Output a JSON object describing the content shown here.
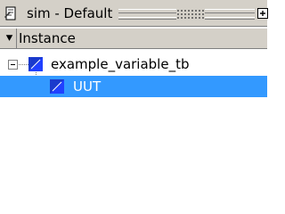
{
  "window": {
    "title": "sim - Default",
    "plus_glyph": "+"
  },
  "header": {
    "column": "Instance"
  },
  "tree": {
    "root": {
      "label": "example_variable_tb",
      "expanded": true,
      "icon": "module-instance-icon"
    },
    "child": {
      "label": "UUT",
      "selected": true,
      "icon": "module-instance-icon"
    }
  },
  "colors": {
    "selection": "#3399ff",
    "chrome": "#d4d0c8",
    "instance_icon": "#1a3acc"
  }
}
